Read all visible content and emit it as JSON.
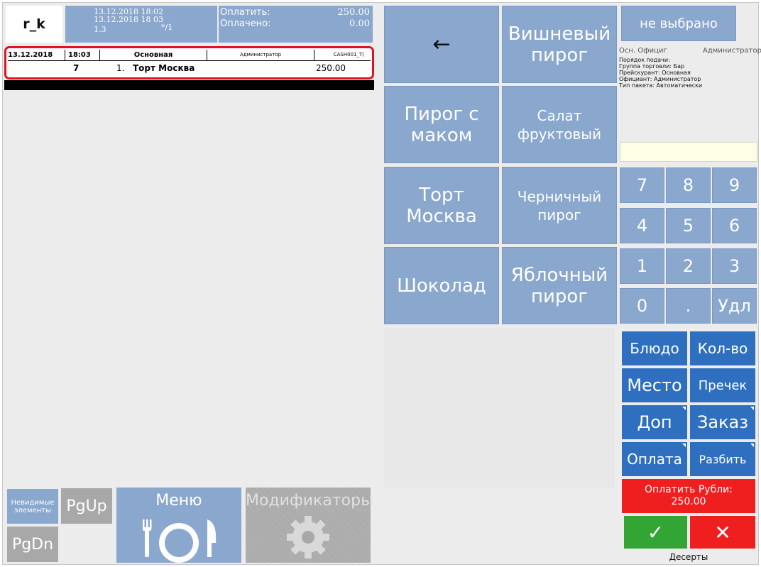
{
  "logo": "r_k",
  "info": {
    "date1": "13.12.2018 18:02",
    "date2": "13.12.2018 18 03",
    "version": "1.3",
    "table_code": "*/1"
  },
  "payment": {
    "to_pay_label": "Оплатить:",
    "to_pay_value": "250.00",
    "paid_label": "Оплачено:",
    "paid_value": "0.00"
  },
  "order_header": {
    "date": "13.12.2018",
    "time": "18:03",
    "name": "Основная",
    "role": "Администратор",
    "station": "CASH001_T("
  },
  "order_lines": [
    {
      "qty": "7",
      "index": "1.",
      "item": "Торт Москва",
      "price": "250.00"
    }
  ],
  "left_bottom": {
    "invisible": "Невидимые элементы",
    "pgup": "PgUp",
    "pgdn": "PgDn",
    "menu": "Меню",
    "modifiers": "Модификаторы"
  },
  "tiles": {
    "back": "←",
    "cherry": "Вишневый пирог",
    "poppy": "Пирог с маком",
    "fruit_salad": "Салат фруктовый",
    "moscow": "Торт Москва",
    "blueberry": "Черничный пирог",
    "chocolate": "Шоколад",
    "apple": "Яблочный пирог"
  },
  "right_panel": {
    "not_selected": "не выбрано",
    "waiter_label": "Осн. Официг",
    "waiter_role": "Администратор",
    "details": [
      "Порядок подачи:",
      "Группа торговли: Бар",
      "Прейскурант: Основная",
      "Официант: Администратор",
      "Тип пакета: Автоматически"
    ]
  },
  "keypad": [
    "7",
    "8",
    "9",
    "4",
    "5",
    "6",
    "1",
    "2",
    "3",
    "0",
    ".",
    "Удл"
  ],
  "functions": {
    "dish": "Блюдо",
    "qty": "Кол-во",
    "place": "Место",
    "precheck": "Пречек",
    "extra": "Доп",
    "order": "Заказ",
    "payment": "Оплата",
    "split": "Разбить"
  },
  "pay_button": {
    "line1": "Оплатить Рубли:",
    "line2": "250.00"
  },
  "confirm": {
    "ok": "✓",
    "cancel": "✕"
  },
  "category": "Десерты",
  "colors": {
    "tile": "#8aa7ce",
    "function": "#2f6fc0",
    "pay": "#f01f1f",
    "ok": "#33a534",
    "cancel": "#f01f1f",
    "highlight": "#e0141c"
  }
}
